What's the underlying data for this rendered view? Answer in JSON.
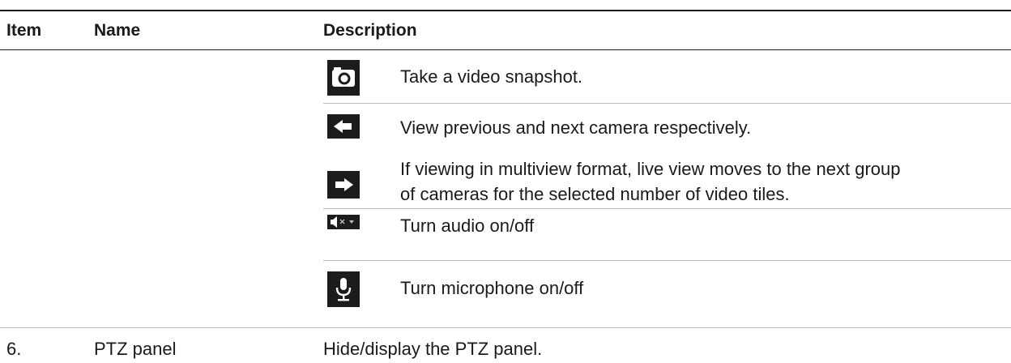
{
  "table": {
    "headers": {
      "item": "Item",
      "name": "Name",
      "description": "Description"
    },
    "rows": [
      {
        "icon": "camera-icon",
        "text": "Take a video snapshot."
      },
      {
        "icon": "arrow-left-icon",
        "text": "View previous and next camera respectively."
      },
      {
        "icon": "arrow-right-icon",
        "text_line1": "If viewing in multiview format, live view moves to the next group",
        "text_line2": "of cameras for the selected number of video tiles."
      },
      {
        "icon": "speaker-mute-icon",
        "text": "Turn audio on/off"
      },
      {
        "icon": "microphone-icon",
        "text": "Turn microphone on/off"
      }
    ],
    "footer_row": {
      "item": "6.",
      "name": "PTZ panel",
      "description": "Hide/display the PTZ panel."
    }
  }
}
